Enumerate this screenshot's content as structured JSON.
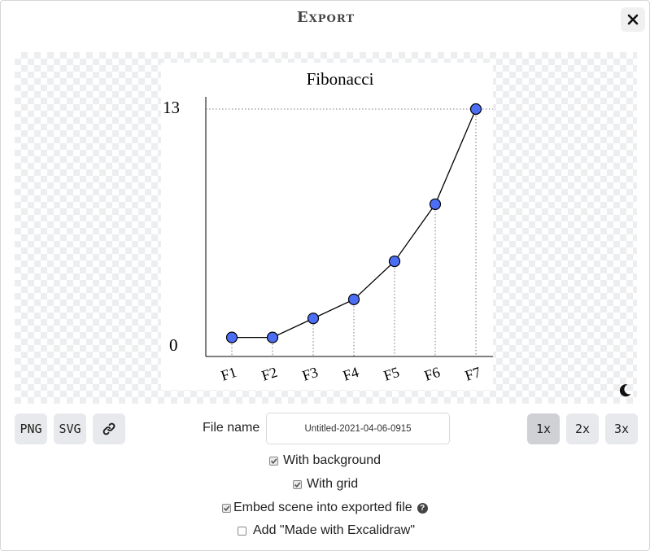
{
  "dialog": {
    "title": "Export",
    "close_icon": "close-icon"
  },
  "chart_data": {
    "type": "line",
    "title": "Fibonacci",
    "categories": [
      "F1",
      "F2",
      "F3",
      "F4",
      "F5",
      "F6",
      "F7"
    ],
    "values": [
      1,
      1,
      2,
      3,
      5,
      8,
      13
    ],
    "y_tick_labels": [
      "0",
      "13"
    ],
    "ylim": [
      0,
      13
    ],
    "grid": false,
    "colors": {
      "point": "#4c6ef5",
      "line": "#000000"
    }
  },
  "theme_toggle": {
    "icon": "moon-icon"
  },
  "export_buttons": {
    "png": "PNG",
    "svg": "SVG",
    "link_icon": "link-icon"
  },
  "file": {
    "label": "File name",
    "value": "Untitled-2021-04-06-0915"
  },
  "scale": {
    "options": [
      "1x",
      "2x",
      "3x"
    ],
    "selected": "1x"
  },
  "options": {
    "with_background": {
      "label": "With background",
      "checked": true
    },
    "with_grid": {
      "label": "With grid",
      "checked": true
    },
    "embed_scene": {
      "label": "Embed scene into exported file",
      "checked": true,
      "help_icon": "question-circle-icon"
    },
    "made_with": {
      "label": "Add \"Made with Excalidraw\"",
      "checked": false
    }
  }
}
